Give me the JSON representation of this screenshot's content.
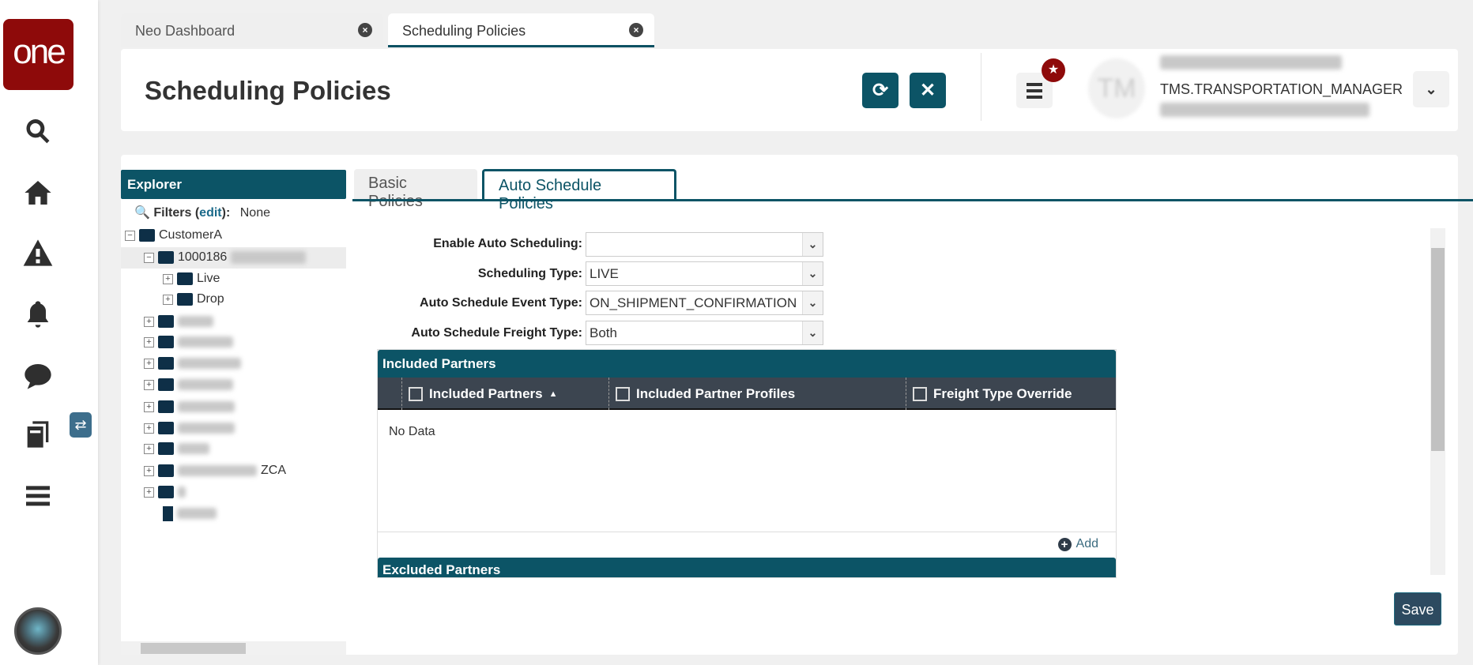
{
  "sidebar": {
    "logo": "one",
    "icons": [
      "search-icon",
      "home-icon",
      "alert-icon",
      "bell-icon",
      "chat-icon",
      "documents-icon",
      "menu-icon"
    ],
    "swap_badge": "⇄"
  },
  "tabs": [
    {
      "label": "Neo Dashboard"
    },
    {
      "label": "Scheduling Policies"
    }
  ],
  "header": {
    "title": "Scheduling Policies",
    "user_initials": "TM",
    "username": "TMS.TRANSPORTATION_MANAGER"
  },
  "explorer": {
    "title": "Explorer",
    "filters_label": "Filters (",
    "filters_edit": "edit",
    "filters_close": "):",
    "filters_value": "None",
    "tree": {
      "root": "CustomerA",
      "child": "1000186",
      "grandchildren": [
        "Live",
        "Drop"
      ],
      "partial_suffix": "ZCA"
    }
  },
  "policy_tabs": {
    "basic": "Basic Policies",
    "auto": "Auto Schedule Policies"
  },
  "form": [
    {
      "label": "Enable Auto Scheduling:",
      "value": ""
    },
    {
      "label": "Scheduling Type:",
      "value": "LIVE"
    },
    {
      "label": "Auto Schedule Event Type:",
      "value": "ON_SHIPMENT_CONFIRMATION"
    },
    {
      "label": "Auto Schedule Freight Type:",
      "value": "Both"
    }
  ],
  "included": {
    "title": "Included Partners",
    "columns": [
      "Included Partners",
      "Included Partner Profiles",
      "Freight Type Override"
    ],
    "sort_indicator": "▲",
    "empty": "No Data",
    "add": "Add"
  },
  "excluded": {
    "title": "Excluded Partners"
  },
  "save": "Save",
  "colors": {
    "accent": "#0c5466",
    "brand": "#8e0a0a"
  }
}
